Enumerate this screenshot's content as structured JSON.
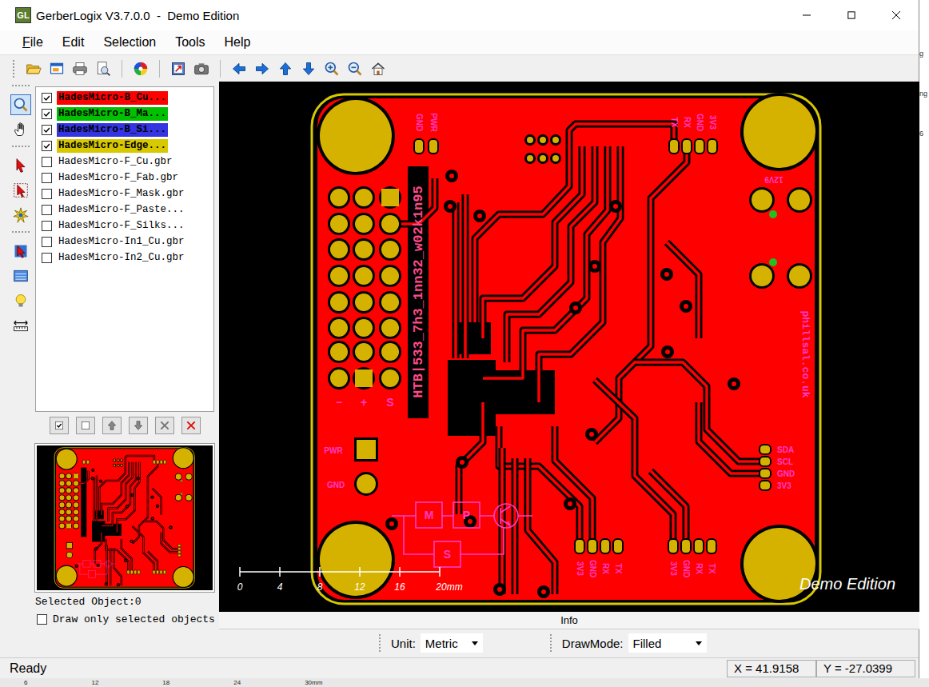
{
  "window": {
    "app_icon": "GL",
    "title": "GerberLogix V3.7.0.0  -  Demo Edition"
  },
  "menu": [
    "File",
    "Edit",
    "Selection",
    "Tools",
    "Help"
  ],
  "tools": [
    {
      "kind": "zoom",
      "selected": true
    },
    {
      "kind": "pan",
      "selected": false
    },
    {
      "kind": "select",
      "selected": false
    },
    {
      "kind": "selectbox",
      "selected": false
    },
    {
      "kind": "highlight",
      "selected": false
    },
    {
      "kind": "pick",
      "selected": false
    },
    {
      "kind": "panel",
      "selected": false
    },
    {
      "kind": "bulb",
      "selected": false
    },
    {
      "kind": "measure",
      "selected": false
    }
  ],
  "layers": [
    {
      "name": "HadesMicro-B_Cu...",
      "checked": true,
      "color": "#ff0000"
    },
    {
      "name": "HadesMicro-B_Ma...",
      "checked": true,
      "color": "#00c000"
    },
    {
      "name": "HadesMicro-B_Si...",
      "checked": true,
      "color": "#3434e0"
    },
    {
      "name": "HadesMicro-Edge...",
      "checked": true,
      "color": "#d8c800"
    },
    {
      "name": "HadesMicro-F_Cu.gbr",
      "checked": false,
      "color": "#ffffff"
    },
    {
      "name": "HadesMicro-F_Fab.gbr",
      "checked": false,
      "color": "#ffffff"
    },
    {
      "name": "HadesMicro-F_Mask.gbr",
      "checked": false,
      "color": "#ffffff"
    },
    {
      "name": "HadesMicro-F_Paste...",
      "checked": false,
      "color": "#ffffff"
    },
    {
      "name": "HadesMicro-F_Silks...",
      "checked": false,
      "color": "#ffffff"
    },
    {
      "name": "HadesMicro-In1_Cu.gbr",
      "checked": false,
      "color": "#ffffff"
    },
    {
      "name": "HadesMicro-In2_Cu.gbr",
      "checked": false,
      "color": "#ffffff"
    }
  ],
  "selected_object": "Selected Object:0",
  "draw_only_selected": {
    "label": "Draw only selected objects",
    "checked": false
  },
  "board": {
    "header_labels": [
      "−",
      "+",
      "S"
    ],
    "power_labels": [
      "PWR",
      "GND"
    ],
    "flag_text": "HTB|533_7h3_1nn32_w02k1n95",
    "url_text": "phillsal.co.uk",
    "led_label": "12V9",
    "top_left_connector": [
      "GND",
      "PWR"
    ],
    "top_right_connector": [
      "TX",
      "RX",
      "GND",
      "3V3"
    ],
    "i2c_connector": [
      "SDA",
      "SCL",
      "GND",
      "3V3"
    ],
    "bottom_connectors": [
      [
        "3V3",
        "GND",
        "RX",
        "TX"
      ],
      [
        "3V3",
        "GND",
        "RX",
        "TX"
      ]
    ],
    "logic_blocks": [
      "M",
      "P",
      "S"
    ]
  },
  "scale": [
    "0",
    "4",
    "8",
    "12",
    "16",
    "20mm"
  ],
  "watermark": "Demo Edition",
  "info": "Info",
  "unit": {
    "label": "Unit:",
    "value": "Metric"
  },
  "draw_mode": {
    "label": "DrawMode:",
    "value": "Filled"
  },
  "status_bar": {
    "text": "Ready",
    "x": "X = 41.9158",
    "y": "Y = -27.0399"
  },
  "background": {
    "ruler": [
      "6",
      "12",
      "18",
      "24",
      "30mm"
    ],
    "fragments": [
      "g",
      "ng",
      "6"
    ]
  }
}
